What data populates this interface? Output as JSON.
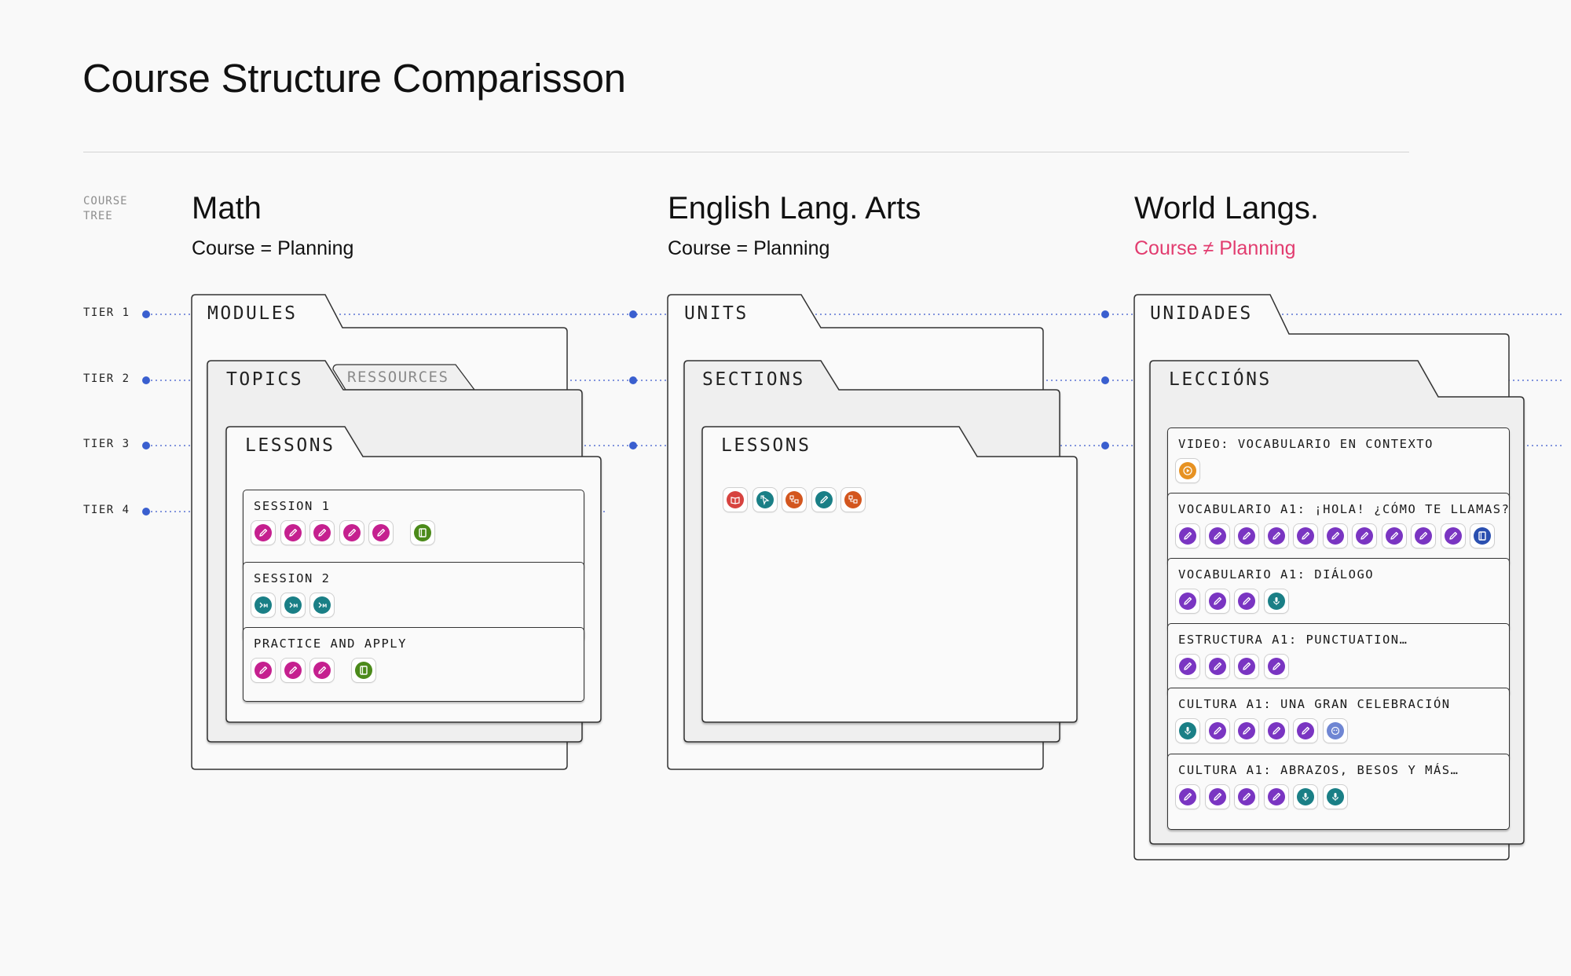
{
  "title": "Course Structure Comparisson",
  "tree_label": "COURSE TREE",
  "tiers": [
    "TIER 1",
    "TIER 2",
    "TIER 3",
    "TIER 4"
  ],
  "colors": {
    "dot": "#3a5fcf",
    "math_pencil": "#c5208f",
    "green": "#4b8a1a",
    "teal": "#1a7f86",
    "red": "#d7433f",
    "orange": "#d3561e",
    "purple": "#7a35c2",
    "video_orange": "#e79222",
    "blue": "#2a4fb0",
    "periwinkle": "#6f86d3",
    "mismatch": "#e23c6f"
  },
  "columns": {
    "math": {
      "title": "Math",
      "subtitle": "Course = Planning",
      "folders": {
        "tier1": "MODULES",
        "tier2": "TOPICS",
        "tier2_extra": "RESSOURCES",
        "tier3": "LESSONS"
      },
      "cards": [
        {
          "label": "SESSION 1",
          "icons": [
            "pencil-icon",
            "pencil-icon",
            "pencil-icon",
            "pencil-icon",
            "pencil-icon",
            "|",
            "notebook-icon"
          ]
        },
        {
          "label": "SESSION 2",
          "icons": [
            "math-gear-icon",
            "math-gear-icon",
            "math-gear-icon"
          ]
        },
        {
          "label": "PRACTICE AND APPLY",
          "icons": [
            "pencil-icon",
            "pencil-icon",
            "pencil-icon",
            "|",
            "notebook-icon"
          ]
        }
      ]
    },
    "ela": {
      "title": "English Lang. Arts",
      "subtitle": "Course = Planning",
      "folders": {
        "tier1": "UNITS",
        "tier2": "SECTIONS",
        "tier3": "LESSONS"
      },
      "icons": [
        "book-icon",
        "cursor-icon",
        "diagram-icon",
        "pencil-icon",
        "diagram-icon"
      ]
    },
    "world": {
      "title": "World Langs.",
      "subtitle": "Course ≠ Planning",
      "folders": {
        "tier1": "UNIDADES",
        "tier2": "LECCIÓNS"
      },
      "cards": [
        {
          "label": "VIDEO: VOCABULARIO EN CONTEXTO",
          "icons": [
            "play-icon"
          ]
        },
        {
          "label": "VOCABULARIO A1: ¡HOLA! ¿CÓMO TE LLAMAS?",
          "icons": [
            "pencil-icon",
            "pencil-icon",
            "pencil-icon",
            "pencil-icon",
            "pencil-icon",
            "pencil-icon",
            "pencil-icon",
            "pencil-icon",
            "pencil-icon",
            "pencil-icon",
            "notebook-icon"
          ]
        },
        {
          "label": "VOCABULARIO A1: DIÁLOGO",
          "icons": [
            "pencil-icon",
            "pencil-icon",
            "pencil-icon",
            "microphone-icon"
          ]
        },
        {
          "label": "ESTRUCTURA A1: PUNCTUATION…",
          "icons": [
            "pencil-icon",
            "pencil-icon",
            "pencil-icon",
            "pencil-icon"
          ]
        },
        {
          "label": "CULTURA A1: UNA GRAN CELEBRACIÓN",
          "icons": [
            "microphone-icon",
            "pencil-icon",
            "pencil-icon",
            "pencil-icon",
            "pencil-icon",
            "chat-icon"
          ]
        },
        {
          "label": "CULTURA A1: ABRAZOS, BESOS Y MÁS…",
          "icons": [
            "pencil-icon",
            "pencil-icon",
            "pencil-icon",
            "pencil-icon",
            "microphone-icon",
            "microphone-icon"
          ]
        }
      ]
    }
  }
}
